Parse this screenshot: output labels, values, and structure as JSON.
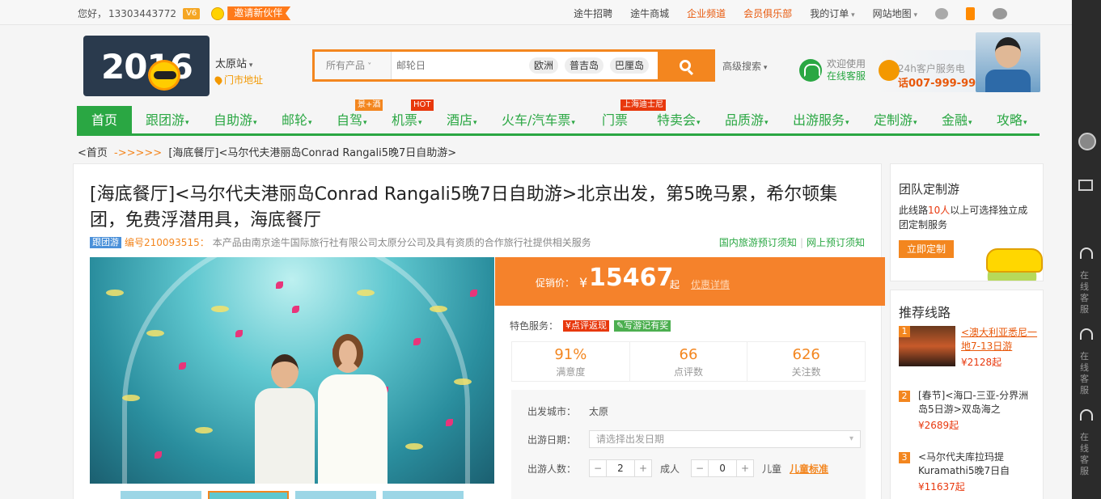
{
  "topbar": {
    "greeting": "您好，",
    "phone": "13303443772",
    "vip": "V6",
    "invite": "邀请新伙伴",
    "links": [
      "途牛招聘",
      "途牛商城",
      "企业频道",
      "会员俱乐部",
      "我的订单",
      "网站地图"
    ]
  },
  "header": {
    "logo_year": "2016",
    "city": "太原站",
    "store": "门市地址",
    "search": {
      "category": "所有产品",
      "placeholder": "邮轮日",
      "hot": [
        "欧洲",
        "普吉岛",
        "巴厘岛"
      ]
    },
    "advanced": "高级搜索",
    "service_line1": "欢迎使用",
    "service_line2": "在线客服",
    "hotline_label": "24h客户服务电",
    "hotline_number": "话007-999-999"
  },
  "nav": {
    "items": [
      "首页",
      "跟团游",
      "自助游",
      "邮轮",
      "自驾",
      "机票",
      "酒店",
      "火车/汽车票",
      "门票",
      "特卖会",
      "品质游",
      "出游服务",
      "定制游",
      "金融",
      "攻略"
    ],
    "badges": {
      "zijia": "景+酒",
      "jipiao": "HOT",
      "menpiao": "上海迪士尼"
    }
  },
  "breadcrumb": {
    "home": "<首页",
    "arrows": "->>>>>",
    "current": "[海底餐厅]<马尔代夫港丽岛Conrad Rangali5晚7日自助游>"
  },
  "product": {
    "title": "[海底餐厅]<马尔代夫港丽岛Conrad Rangali5晚7日自助游>北京出发，第5晚马累，希尔顿集团，免费浮潜用具，海底餐厅",
    "category_tag": "跟团游",
    "code": "编号210093515：",
    "provider": "本产品由南京途牛国际旅行社有限公司太原分公司及具有资质的合作旅行社提供相关服务",
    "notice1": "国内旅游预订须知",
    "notice2": "网上预订须知"
  },
  "price": {
    "label": "促销价：",
    "yen": "¥",
    "value": "15467",
    "qi": "起",
    "deal": "优惠详情"
  },
  "booking": {
    "feature_label": "特色服务：",
    "feature1": "¥点评返现",
    "feature2": "✎写游记有奖",
    "stats": [
      {
        "value": "91%",
        "label": "满意度"
      },
      {
        "value": "66",
        "label": "点评数"
      },
      {
        "value": "626",
        "label": "关注数"
      }
    ],
    "city_label": "出发城市：",
    "city_value": "太原",
    "date_label": "出游日期：",
    "date_placeholder": "请选择出发日期",
    "people_label": "出游人数：",
    "adults": "2",
    "adult_label": "成人",
    "children": "0",
    "child_label": "儿童",
    "child_std": "儿童标准"
  },
  "sidebar": {
    "custom_title": "团队定制游",
    "custom_desc_a": "此线路",
    "custom_desc_num": "10人",
    "custom_desc_b": "以上可选择独立成团定制服务",
    "custom_button": "立即定制",
    "rec_title": "推荐线路",
    "recs": [
      {
        "no": "1",
        "title": "<澳大利亚悉尼一地7-13日游",
        "price": "¥2128起"
      },
      {
        "no": "2",
        "title": "[春节]<海口-三亚-分界洲岛5日游>双岛海之",
        "price": "¥2689起"
      },
      {
        "no": "3",
        "title": "<马尔代夫库拉玛提Kuramathi5晚7日自",
        "price": "¥11637起"
      }
    ]
  },
  "strip": {
    "cs_text": "在线客服"
  }
}
